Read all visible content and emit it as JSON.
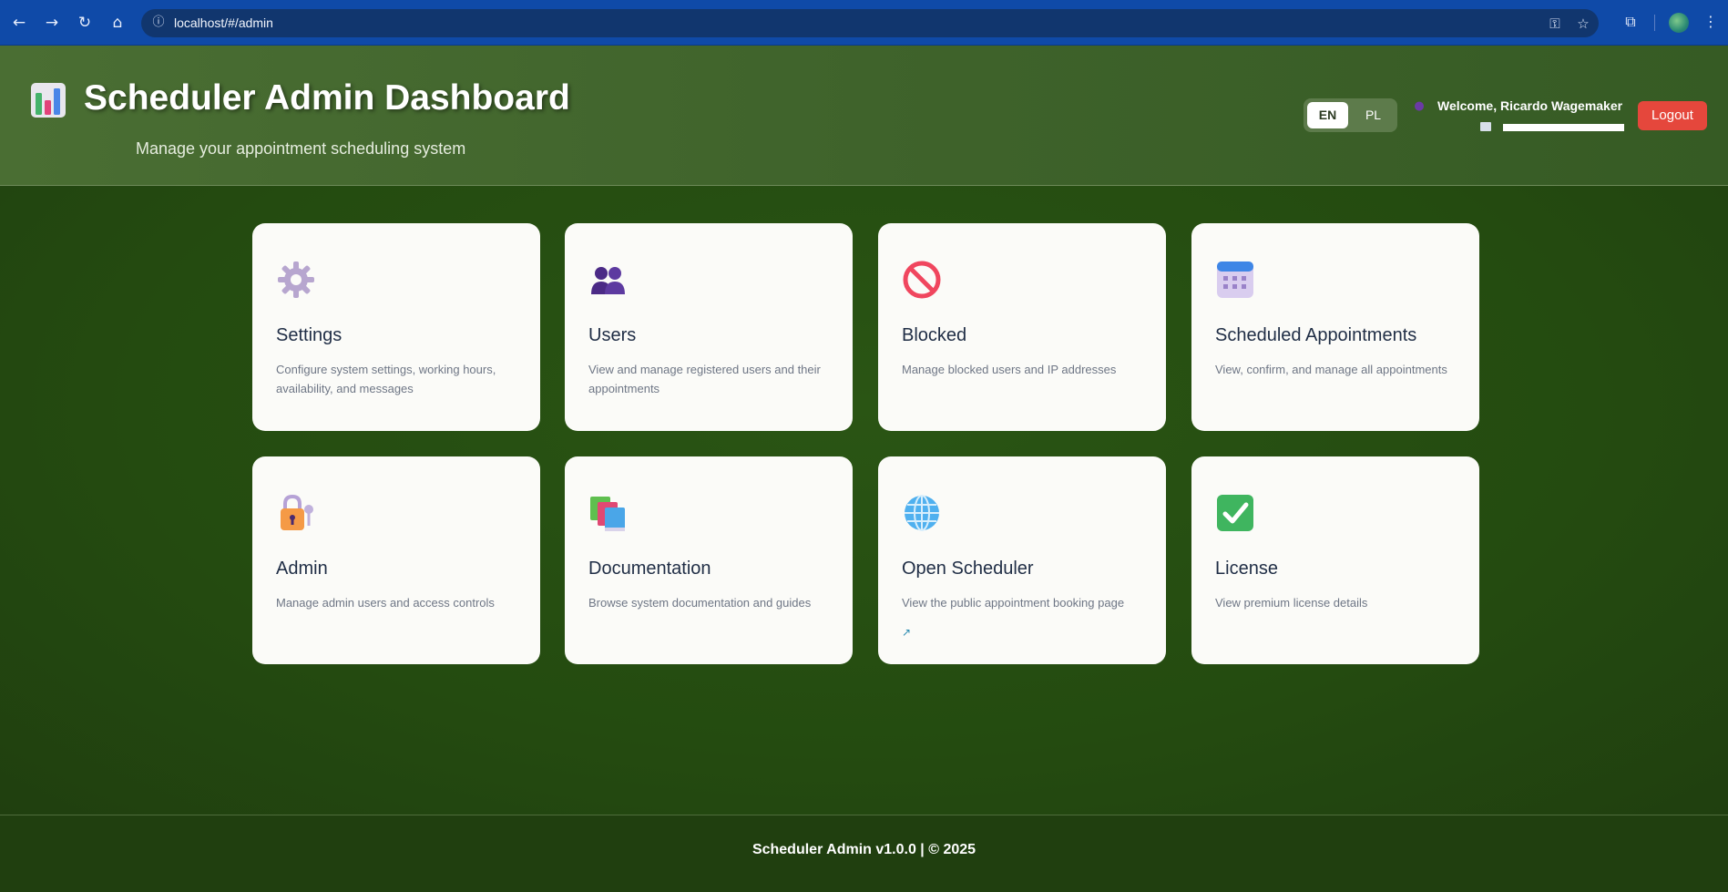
{
  "browser": {
    "url": "localhost/#/admin",
    "back_icon": "arrow-left-icon",
    "forward_icon": "arrow-right-icon",
    "reload_icon": "reload-icon",
    "home_icon": "home-icon"
  },
  "header": {
    "title": "Scheduler Admin Dashboard",
    "subtitle": "Manage your appointment scheduling system",
    "languages": [
      {
        "label": "EN",
        "active": true
      },
      {
        "label": "PL",
        "active": false
      }
    ],
    "welcome": "Welcome, Ricardo Wagemaker",
    "logout_label": "Logout"
  },
  "cards": [
    {
      "title": "Settings",
      "description": "Configure system settings, working hours, availability, and messages",
      "icon": "gear-icon"
    },
    {
      "title": "Users",
      "description": "View and manage registered users and their appointments",
      "icon": "users-icon"
    },
    {
      "title": "Blocked",
      "description": "Manage blocked users and IP addresses",
      "icon": "prohibited-icon"
    },
    {
      "title": "Scheduled Appointments",
      "description": "View, confirm, and manage all appointments",
      "icon": "calendar-icon"
    },
    {
      "title": "Admin",
      "description": "Manage admin users and access controls",
      "icon": "lock-key-icon"
    },
    {
      "title": "Documentation",
      "description": "Browse system documentation and guides",
      "icon": "books-icon"
    },
    {
      "title": "Open Scheduler",
      "description": "View the public appointment booking page",
      "icon": "globe-icon",
      "external": "↗"
    },
    {
      "title": "License",
      "description": "View premium license details",
      "icon": "check-box-icon"
    }
  ],
  "footer": {
    "text": "Scheduler Admin v1.0.0 | © 2025"
  },
  "colors": {
    "browser_bar": "#0f4aa8",
    "header_bg": "#4a6e33",
    "main_bg": "#254b12",
    "logout_bg": "#e5473c",
    "card_bg": "#fbfbf8"
  }
}
